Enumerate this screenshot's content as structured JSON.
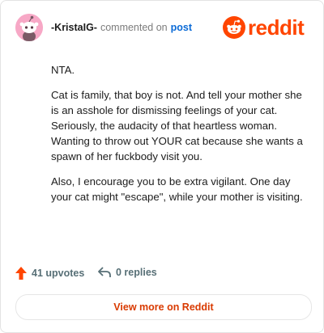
{
  "comment": {
    "username": "-KristaIG-",
    "action_text": "commented on",
    "post_link_text": "post",
    "paragraphs": [
      "NTA.",
      "Cat is family, that boy is not. And tell your mother she is an asshole for dismissing feelings of your cat. Seriously, the audacity of that heartless woman. Wanting to throw out YOUR cat because she wants a spawn of her fuckbody visit you.",
      "Also, I encourage you to be extra vigilant. One day your cat might \"escape\", while your mother is visiting."
    ]
  },
  "brand": {
    "wordmark": "reddit",
    "icon": "reddit-snoo-icon",
    "color": "#ff4500"
  },
  "stats": {
    "upvotes_label": "41 upvotes",
    "upvote_icon": "upvote-arrow-icon",
    "upvote_icon_color": "#ff4500",
    "replies_label": "0 replies",
    "reply_icon": "reply-arrow-icon"
  },
  "footer": {
    "view_more_label": "View more on Reddit",
    "view_more_color": "#d93a00"
  },
  "avatar": {
    "icon": "snoo-avatar-icon",
    "background": "#f7a8c6"
  }
}
